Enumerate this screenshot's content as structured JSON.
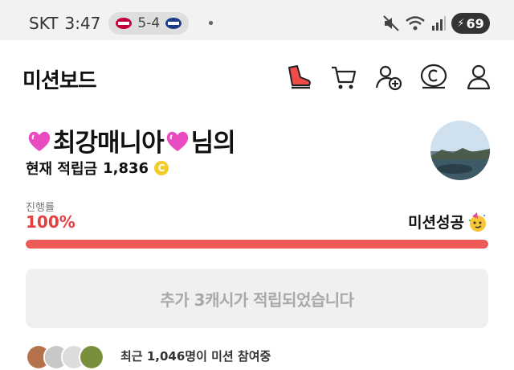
{
  "status_bar": {
    "carrier": "SKT",
    "time": "3:47",
    "score": "5-4",
    "battery": "69"
  },
  "header": {
    "title": "미션보드"
  },
  "profile": {
    "nickname": "최강매니아",
    "suffix": "님의",
    "points_label": "현재 적립금",
    "points_value": "1,836",
    "coin_symbol": "C"
  },
  "progress": {
    "label": "진행률",
    "value_text": "100%",
    "fraction": 1.0,
    "status_text": "미션성공"
  },
  "reward": {
    "button_label": "추가 3캐시가 적립되었습니다"
  },
  "bottom": {
    "text": "최근 1,046명이 미션 참여중"
  },
  "colors": {
    "accent_red": "#e2413f",
    "coin_yellow": "#f3cc2c"
  }
}
